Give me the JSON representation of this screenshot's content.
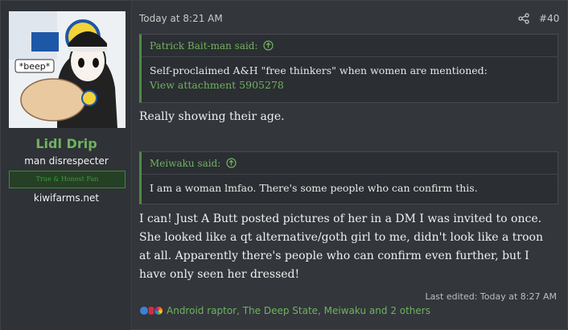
{
  "user": {
    "name": "Lidl Drip",
    "title": "man disrespecter",
    "banner": "True & Honest Fan",
    "site": "kiwifarms.net",
    "avatar_text": "*beep*"
  },
  "post": {
    "date": "Today at 8:21 AM",
    "number": "#40",
    "quotes": [
      {
        "author": "Patrick Bait-man said:",
        "text": "Self-proclaimed A&H \"free thinkers\" when women are mentioned:",
        "attachment": "View attachment 5905278"
      },
      {
        "author": "Meiwaku said:",
        "text": "I am a woman lmfao. There's some people who can confirm this."
      }
    ],
    "reply1": "Really showing their age.",
    "reply2": "I can! Just A Butt posted pictures of her in a DM I was invited to once. She looked like a qt alternative/goth girl to me, didn't look like a troon at all. Apparently there's people who can confirm even further, but I have only seen her dressed!",
    "last_edited": "Last edited: Today at 8:27 AM"
  },
  "reactions": {
    "icons": [
      "like-icon",
      "heart-icon",
      "rainbow-icon"
    ],
    "list": "Android raptor, The Deep State, Meiwaku and 2 others"
  },
  "colors": {
    "accent": "#6fb35e",
    "background": "#33363b",
    "quote_border": "#4f8a45"
  }
}
